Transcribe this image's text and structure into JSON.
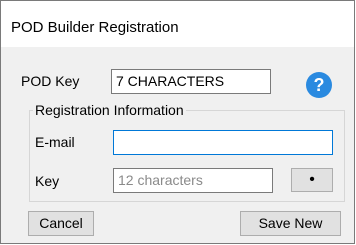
{
  "window": {
    "title": "POD Builder Registration"
  },
  "pod_key": {
    "label": "POD Key",
    "value": "7 CHARACTERS"
  },
  "help": {
    "glyph": "?"
  },
  "registration": {
    "group_title": "Registration Information",
    "email": {
      "label": "E-mail",
      "value": ""
    },
    "key": {
      "label": "Key",
      "placeholder": "12 characters"
    },
    "browse_glyph": "•"
  },
  "buttons": {
    "cancel": "Cancel",
    "save_new": "Save New"
  },
  "colors": {
    "help_icon": "#2a8ae0",
    "focus_border": "#0078d7"
  }
}
